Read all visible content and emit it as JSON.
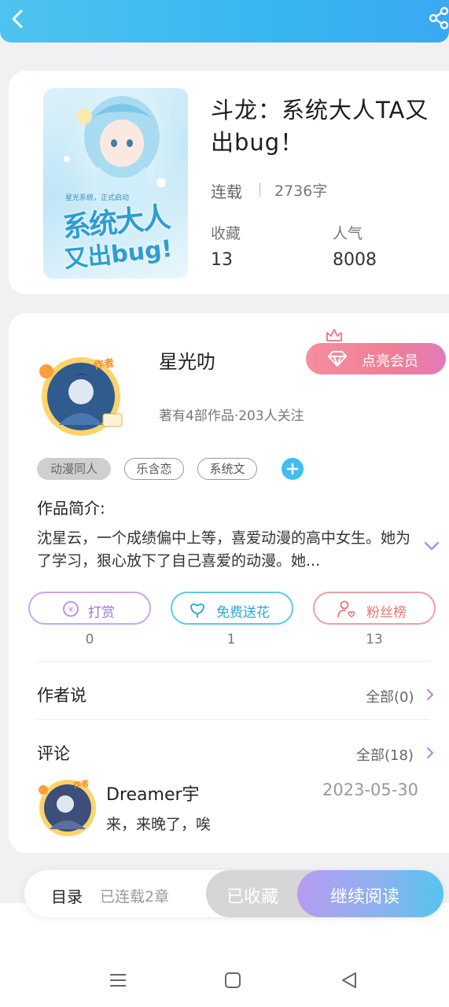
{
  "header": {
    "back_icon": "chevron-left-icon",
    "share_icon": "share-icon"
  },
  "book": {
    "title": "斗龙：系统大人TA又出bug！",
    "status": "连载",
    "word_count": "2736字",
    "favorites_label": "收藏",
    "favorites_value": "13",
    "popularity_label": "人气",
    "popularity_value": "8008",
    "cover_text_top": "系统大人",
    "cover_text_bottom": "又出bug!",
    "cover_subtitle": "星光系统，正式启动"
  },
  "author": {
    "name": "星光叻",
    "badge": "作者",
    "vip_button": "点亮会员",
    "meta": "著有4部作品·203人关注",
    "tags": [
      "动漫同人",
      "乐含恋",
      "系统文"
    ]
  },
  "intro": {
    "label": "作品简介:",
    "text": "沈星云，一个成绩偏中上等，喜爱动漫的高中女生。她为了学习，狠心放下了自己喜爱的动漫。她..."
  },
  "actions": [
    {
      "label": "打赏",
      "count": "0",
      "icon": "yen-coin-icon"
    },
    {
      "label": "免费送花",
      "count": "1",
      "icon": "flower-icon"
    },
    {
      "label": "粉丝榜",
      "count": "13",
      "icon": "fan-user-icon"
    }
  ],
  "author_says": {
    "title": "作者说",
    "link": "全部(0)"
  },
  "comments": {
    "title": "评论",
    "link": "全部(18)",
    "items": [
      {
        "name": "Dreamer宇",
        "date": "2023-05-30",
        "text": "来，来晚了，唉",
        "badge": "作者"
      }
    ]
  },
  "bottom_bar": {
    "toc_label": "目录",
    "toc_status": "已连载2章",
    "collected_label": "已收藏",
    "read_label": "继续阅读"
  },
  "colors": {
    "accent_blue": "#41bdf0",
    "vip_pink": "#ef7f95",
    "reward_purple": "#9c74d8",
    "flower_blue": "#2aa7d8",
    "fans_red": "#e47878"
  }
}
